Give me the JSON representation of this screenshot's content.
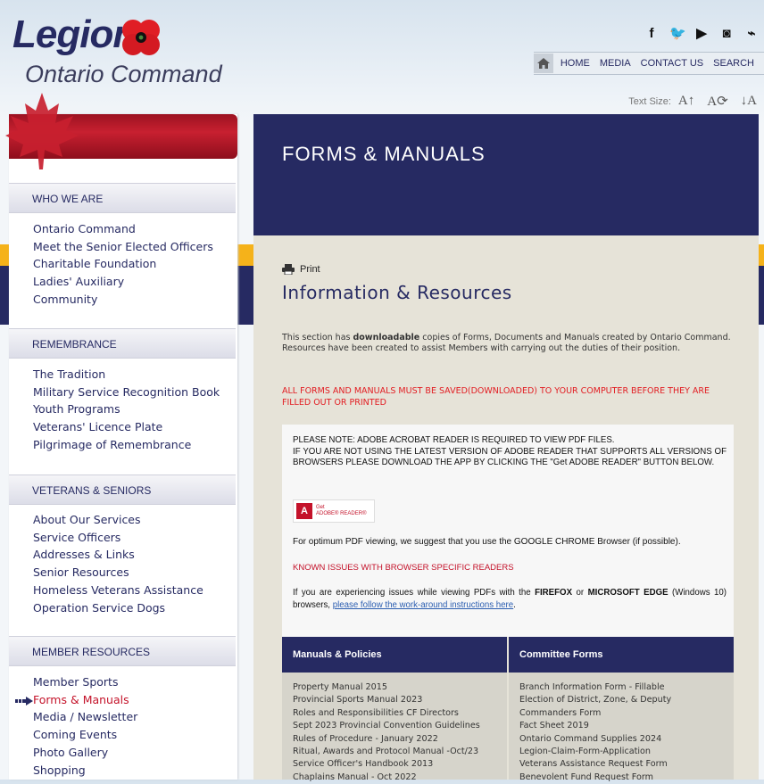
{
  "header": {
    "logo_word": "Legion",
    "logo_sub": "Ontario Command",
    "social": [
      {
        "icon": "facebook-icon",
        "glyph": "f"
      },
      {
        "icon": "twitter-icon",
        "glyph": "🐦"
      },
      {
        "icon": "youtube-icon",
        "glyph": "▶"
      },
      {
        "icon": "flickr-icon",
        "glyph": "◙"
      },
      {
        "icon": "rss-icon",
        "glyph": "⌁"
      }
    ],
    "nav": [
      "HOME",
      "MEDIA",
      "CONTACT US",
      "SEARCH"
    ],
    "text_size_label": "Text Size:",
    "text_size_buttons": [
      "A↑",
      "A⟳",
      "↓A"
    ]
  },
  "sidebar": {
    "sections": [
      {
        "title": "WHO WE ARE",
        "items": [
          "Ontario Command",
          "Meet the Senior Elected Officers",
          "Charitable Foundation",
          "Ladies' Auxiliary",
          "Community"
        ]
      },
      {
        "title": "REMEMBRANCE",
        "items": [
          "The Tradition",
          "Military Service Recognition Book",
          "Youth Programs",
          "Veterans' Licence Plate",
          "Pilgrimage of Remembrance"
        ]
      },
      {
        "title": "VETERANS & SENIORS",
        "items": [
          "About Our Services",
          "Service Officers",
          "Addresses & Links",
          "Senior Resources",
          "Homeless Veterans Assistance",
          "Operation Service Dogs"
        ]
      },
      {
        "title": "MEMBER RESOURCES",
        "items": [
          "Member Sports",
          "Forms & Manuals",
          "Media / Newsletter",
          "Coming Events",
          "Photo Gallery",
          "Shopping"
        ]
      }
    ],
    "active_item": "Forms & Manuals"
  },
  "main": {
    "page_title": "FORMS & MANUALS",
    "print_label": "Print",
    "heading": "Information & Resources",
    "intro_prefix": "This section has ",
    "intro_bold": "downloadable",
    "intro_suffix": " copies of Forms, Documents and Manuals created by Ontario Command.",
    "intro_line2": "Resources have been created to assist Members with carrying out the duties of their position.",
    "warning": "ALL FORMS AND MANUALS MUST BE SAVED(DOWNLOADED) TO YOUR COMPUTER BEFORE THEY ARE FILLED OUT OR PRINTED",
    "notice": {
      "line1": "PLEASE NOTE:  ADOBE ACROBAT READER IS REQUIRED TO VIEW PDF FILES.",
      "line2": "IF YOU ARE NOT USING THE LATEST VERSION OF ADOBE READER THAT SUPPORTS ALL VERSIONS OF BROWSERS PLEASE DOWNLOAD THE APP BY CLICKING THE \"Get ADOBE READER\" BUTTON BELOW.",
      "adobe_get": "Get",
      "adobe_reader": "ADOBE® READER®",
      "chrome_tip": "For optimum PDF viewing, we suggest that you use the GOOGLE CHROME Browser (if possible).",
      "known_issues": "KNOWN ISSUES WITH BROWSER SPECIFIC READERS",
      "issue_a": "If you are experiencing issues while viewing PDFs with the ",
      "issue_firefox": "FIREFOX",
      "issue_or": " or ",
      "issue_edge": "MICROSOFT EDGE",
      "issue_b": " (Windows 10) browsers, ",
      "issue_link": "please follow the work-around instructions here",
      "issue_end": "."
    },
    "table": {
      "col1_header": "Manuals & Policies",
      "col2_header": "Committee Forms",
      "col1": [
        "Property Manual 2015",
        "Provincial Sports Manual 2023",
        "Roles and Responsibilities CF Directors",
        "Sept 2023 Provincial Convention Guidelines",
        "Rules of Procedure - January 2022",
        "Ritual, Awards and Protocol Manual -Oct/23",
        "Service Officer's Handbook 2013",
        "Chaplains Manual - Oct 2022"
      ],
      "col2": [
        "Branch Information Form - Fillable",
        "Election of District, Zone, & Deputy",
        "Commanders Form",
        "Fact Sheet 2019",
        "Ontario Command Supplies 2024",
        "Legion-Claim-Form-Application",
        "Veterans Assistance Request Form",
        "Benevolent Fund Request Form"
      ]
    }
  }
}
